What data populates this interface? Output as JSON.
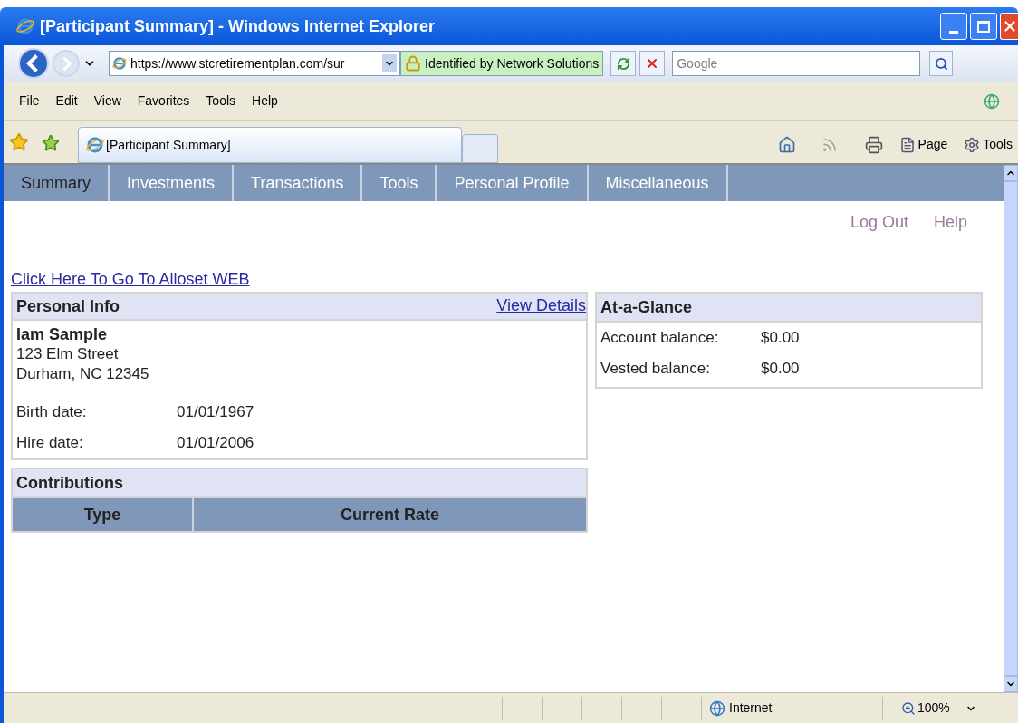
{
  "window": {
    "title": "[Participant Summary] - Windows Internet Explorer"
  },
  "address_bar": {
    "url": "https://www.stcretirementplan.com/sur",
    "security_label": "Identified by Network Solutions"
  },
  "search": {
    "placeholder": "Google"
  },
  "menu": [
    "File",
    "Edit",
    "View",
    "Favorites",
    "Tools",
    "Help"
  ],
  "browser_tab": {
    "label": "[Participant Summary]"
  },
  "command_bar": [
    {
      "kind": "page",
      "label": "Page"
    },
    {
      "kind": "tools",
      "label": "Tools"
    }
  ],
  "nav_tabs": [
    {
      "label": "Summary",
      "selected": true
    },
    {
      "label": "Investments",
      "selected": false
    },
    {
      "label": "Transactions",
      "selected": false
    },
    {
      "label": "Tools",
      "selected": false
    },
    {
      "label": "Personal Profile",
      "selected": false
    },
    {
      "label": "Miscellaneous",
      "selected": false
    }
  ],
  "top_links": [
    "Log Out",
    "Help"
  ],
  "alloset_link": "Click Here To Go To Alloset WEB",
  "personal_info": {
    "title": "Personal Info",
    "view_details": "View Details",
    "name": "Iam Sample",
    "address_lines": [
      "123 Elm Street",
      "Durham, NC 12345"
    ],
    "fields": [
      {
        "label": "Birth date:",
        "value": "01/01/1967"
      },
      {
        "label": "Hire date:",
        "value": "01/01/2006"
      }
    ]
  },
  "contributions": {
    "title": "Contributions",
    "columns": [
      "Type",
      "Current Rate"
    ]
  },
  "at_a_glance": {
    "title": "At-a-Glance",
    "rows": [
      {
        "label": "Account balance:",
        "value": "$0.00"
      },
      {
        "label": "Vested balance:",
        "value": "$0.00"
      }
    ]
  },
  "status_bar": {
    "zone": "Internet",
    "zoom": "100%"
  }
}
